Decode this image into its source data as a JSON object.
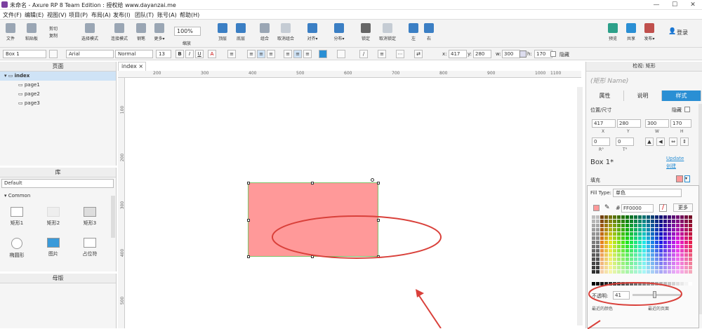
{
  "window": {
    "title": "未命名 - Axure RP 8 Team Edition : 授权给 www.dayanzai.me",
    "minimize": "—",
    "maximize": "☐",
    "close": "✕"
  },
  "menu": [
    "文件(F)",
    "编辑(E)",
    "视图(V)",
    "项目(P)",
    "布局(A)",
    "发布(I)",
    "团队(T)",
    "账号(A)",
    "帮助(H)"
  ],
  "toolbar": {
    "file": "文件",
    "paste": "粘贴板",
    "cut": "剪切",
    "copy": "复制",
    "select_mode": "选择模式",
    "connect": "连接模式",
    "pen": "钢笔",
    "more": "更多▾",
    "zoom": "100%",
    "zoom_label": "缩放",
    "top": "顶层",
    "bottom": "底层",
    "group": "组合",
    "ungroup": "取消组合",
    "align": "对齐▾",
    "distribute": "分布▾",
    "lock": "锁定",
    "unlock": "取消锁定",
    "left": "左",
    "right": "右",
    "preview": "预览",
    "share": "共享",
    "publish": "发布▾",
    "login": "登录"
  },
  "format": {
    "widget": "Box 1",
    "font": "Arial",
    "style": "Normal",
    "size": "13",
    "bold": "B",
    "italic": "I",
    "underline": "U",
    "x_label": "x:",
    "x": "417",
    "y_label": "y:",
    "y": "280",
    "w_label": "w:",
    "w": "300",
    "h_label": "h:",
    "h": "170",
    "hidden": "隐藏"
  },
  "pages": {
    "title": "页面",
    "items": [
      "index",
      "page1",
      "page2",
      "page3"
    ]
  },
  "library": {
    "title": "库",
    "selected": "Default",
    "group": "Common",
    "widgets": [
      "矩形1",
      "矩形2",
      "矩形3",
      "椭圆形",
      "图片",
      "占位符"
    ]
  },
  "masters": {
    "title": "母版"
  },
  "canvas": {
    "tab": "index",
    "ruler_x": [
      "200",
      "300",
      "400",
      "500",
      "600",
      "700",
      "800",
      "900",
      "1000",
      "1100"
    ],
    "ruler_y": [
      "100",
      "200",
      "300",
      "400",
      "500"
    ]
  },
  "inspector": {
    "title": "检视: 矩形",
    "name_placeholder": "(矩形 Name)",
    "tabs": [
      "属性",
      "说明",
      "样式"
    ],
    "pos_size": "位置/尺寸",
    "hidden": "隐藏",
    "x": "417",
    "y": "280",
    "w": "300",
    "h": "170",
    "xl": "X",
    "yl": "Y",
    "wl": "W",
    "hl": "H",
    "rot": "0",
    "rot2": "0",
    "rl": "R°",
    "tl": "T°",
    "style_name": "Box 1*",
    "update": "Update",
    "create": "创建",
    "fill": "填充",
    "fill_type_label": "Fill Type:",
    "fill_type": "单色",
    "hex_prefix": "#",
    "hex": "FF0000",
    "more": "更多",
    "opacity_label": "不透明:",
    "opacity": "41",
    "recent_label": "最近的颜色",
    "recent_page_label": "最近的页面"
  },
  "colors": {
    "accent": "#2a8fd4",
    "shape_fill": "#ff9999",
    "annotation": "#d9403a"
  }
}
